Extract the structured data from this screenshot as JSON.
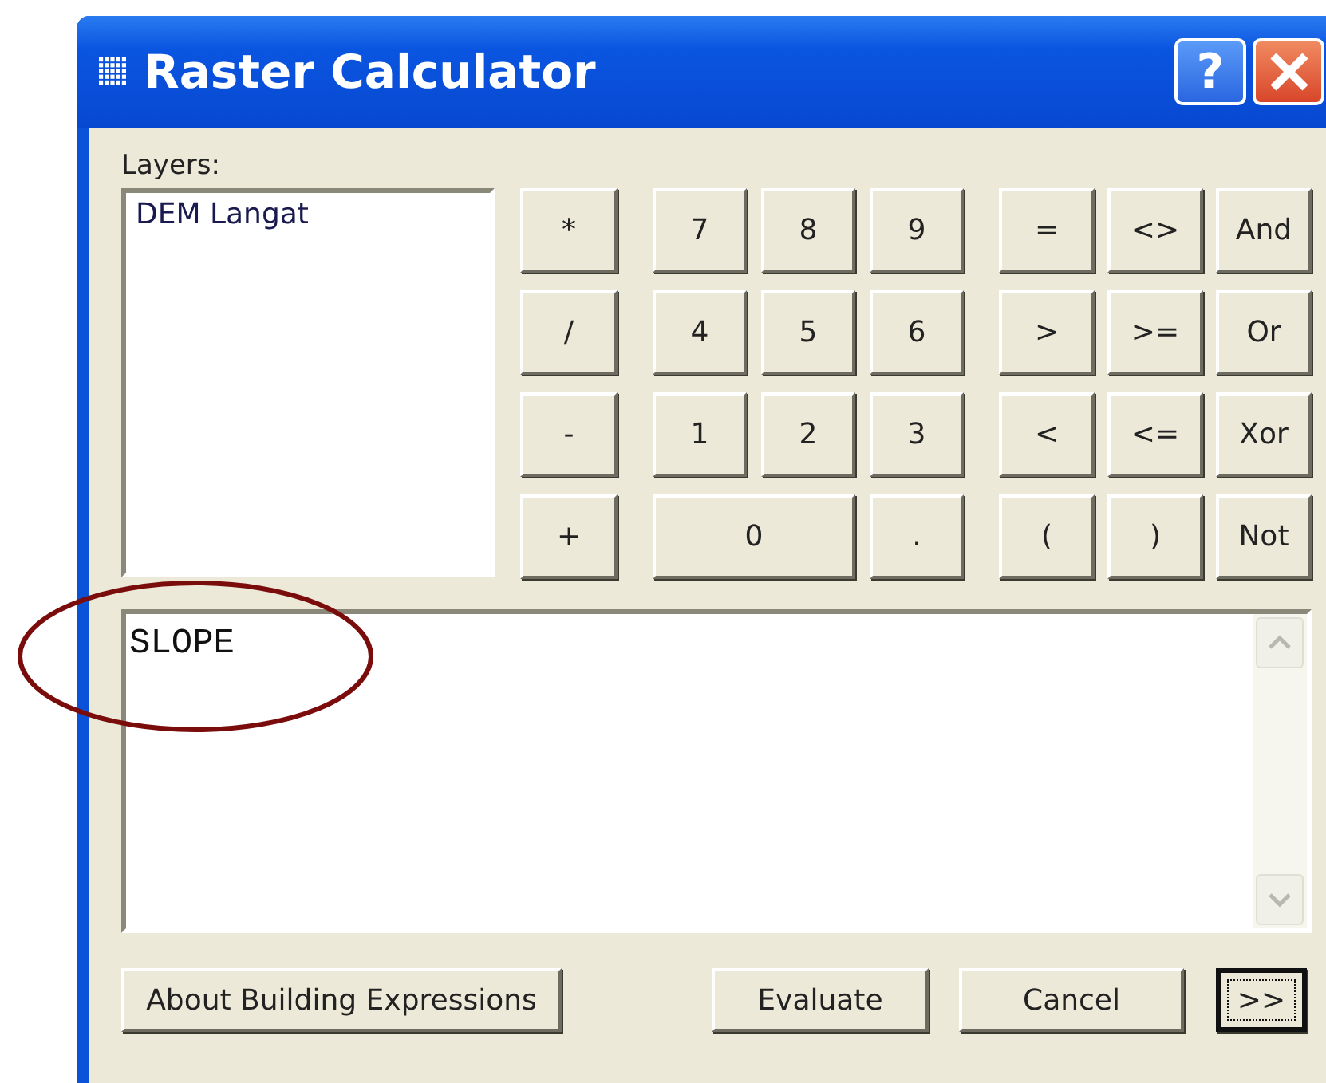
{
  "window": {
    "title": "Raster Calculator",
    "help_button": "?"
  },
  "layers": {
    "label": "Layers:",
    "items": [
      {
        "name": "DEM Langat",
        "selected": false
      }
    ]
  },
  "operator_keys": [
    "*",
    "/",
    "-",
    "+"
  ],
  "digit_keys": [
    {
      "label": "7",
      "kind": "normal"
    },
    {
      "label": "8",
      "kind": "normal"
    },
    {
      "label": "9",
      "kind": "normal"
    },
    {
      "label": "4",
      "kind": "normal"
    },
    {
      "label": "5",
      "kind": "normal"
    },
    {
      "label": "6",
      "kind": "normal"
    },
    {
      "label": "1",
      "kind": "normal"
    },
    {
      "label": "2",
      "kind": "normal"
    },
    {
      "label": "3",
      "kind": "normal"
    },
    {
      "label": "0",
      "kind": "wide"
    },
    {
      "label": ".",
      "kind": "normal"
    }
  ],
  "logic_keys": [
    "=",
    "<>",
    "And",
    ">",
    ">=",
    "Or",
    "<",
    "<=",
    "Xor",
    "(",
    ")",
    "Not"
  ],
  "expression": {
    "value": "SLOPE"
  },
  "buttons": [
    {
      "label": "About Building Expressions",
      "default": false
    },
    {
      "label": "Evaluate",
      "default": false
    },
    {
      "label": "Cancel",
      "default": false
    },
    {
      "label": ">>",
      "default": true
    }
  ]
}
